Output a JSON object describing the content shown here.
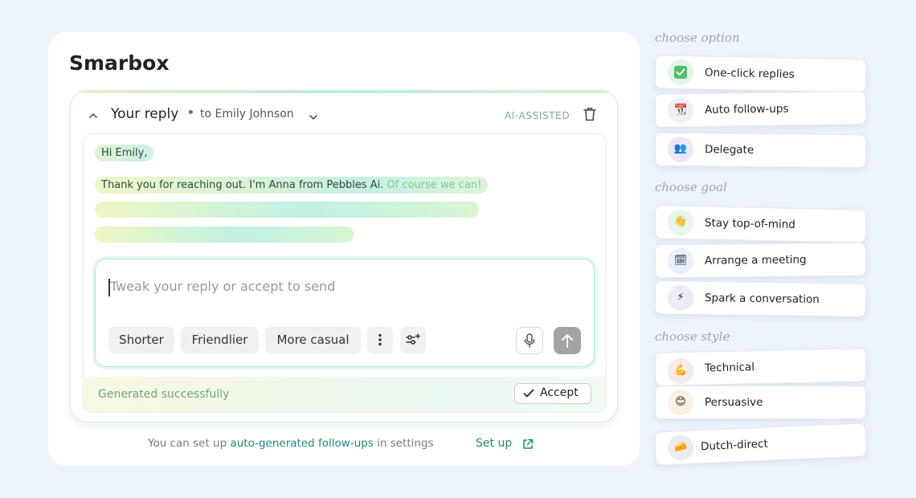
{
  "app": {
    "title": "Smarbox"
  },
  "reply": {
    "header_title": "Your reply",
    "recipient": "to Emily Johnson",
    "badge": "AI-ASSISTED",
    "greeting": "Hi Emily,",
    "line1_main": "Thank you for reaching out. I'm Anna from Pebbles Ai.",
    "line1_faded": "Of course we can!",
    "input": {
      "placeholder": "Tweak your reply or accept to send",
      "value": ""
    },
    "chips": [
      "Shorter",
      "Friendlier",
      "More casual"
    ],
    "status": "Generated successfully",
    "accept_label": "Accept"
  },
  "footer": {
    "prefix": "You can set up",
    "link": "auto-generated follow-ups",
    "suffix": "in settings",
    "setup_label": "Set up"
  },
  "options": {
    "option_label": "choose option",
    "option_items": [
      {
        "label": "One-click replies",
        "icon": "checkmark-icon"
      },
      {
        "label": "Auto follow-ups",
        "icon": "calendar-icon"
      },
      {
        "label": "Delegate",
        "icon": "people-icon"
      }
    ],
    "goal_label": "choose goal",
    "goal_items": [
      {
        "label": "Stay top-of-mind",
        "icon": "wave-icon"
      },
      {
        "label": "Arrange a meeting",
        "icon": "calendar-icon"
      },
      {
        "label": "Spark a conversation",
        "icon": "lightning-icon"
      }
    ],
    "style_label": "choose style",
    "style_items": [
      {
        "label": "Technical",
        "icon": "muscle-icon"
      },
      {
        "label": "Persuasive",
        "icon": "smile-icon"
      },
      {
        "label": "Dutch-direct",
        "icon": "cheese-icon"
      }
    ]
  },
  "colors": {
    "accent": "#1f8b7c",
    "success": "#6da876",
    "ai_badge": "#6cb97f",
    "background": "#eef4fc"
  }
}
